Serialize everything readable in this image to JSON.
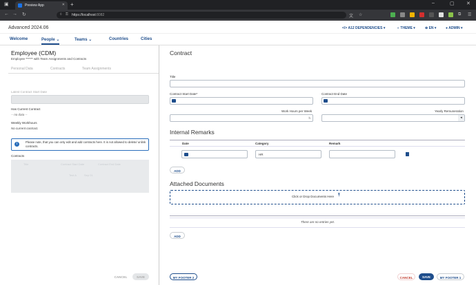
{
  "browser": {
    "tab_title": "Preview App",
    "url_host": "https://localhost",
    "url_port": ":8082"
  },
  "app": {
    "title": "Advanced 2024.06",
    "header": {
      "dependencies": "A12 DEPENDENCIES",
      "theme": "THEME",
      "language": "EN",
      "user": "ADMIN"
    },
    "nav": [
      "Welcome",
      "People",
      "Teams",
      "Countries",
      "Cities"
    ]
  },
  "left": {
    "title": "Employee (CDM)",
    "subtitle": "Employee ****** with Team Assignments and Contracts",
    "tabs": [
      "Personal Data",
      "Contracts",
      "Team Assignments"
    ],
    "latest_contract_label": "Latest Contract Start Date",
    "has_current_label": "Has Current Contract",
    "has_current_value": "-- no data --",
    "weekly_label": "Weekly Workhours",
    "weekly_value": "No current contract.",
    "info_text": "Please note, that you can only edit and add contracts here. It is not allowed to delete/ unlink contracts.",
    "contracts_label": "Contracts",
    "contracts_table": {
      "headers": [
        "Title",
        "Contract Start Date",
        "Contract End Date"
      ],
      "row": [
        "Test A",
        "Sep 01"
      ]
    },
    "cancel": "CANCEL",
    "save": "SAVE"
  },
  "right": {
    "title": "Contract",
    "title_label": "Title",
    "start_label": "Contract Start Date*",
    "end_label": "Contract End Date",
    "hours_label": "Work Hours per Week",
    "hours_unit": "h",
    "remun_label": "Yearly Remuneration",
    "remarks_title": "Internal Remarks",
    "remarks_headers": [
      "Date",
      "Category",
      "Remark"
    ],
    "remarks_category": "HR",
    "add": "ADD",
    "docs_title": "Attached Documents",
    "drop_text": "Click or Drop Documents Here",
    "no_entries": "There are no entries yet.",
    "add2": "ADD"
  },
  "footer": {
    "footer2": "MY FOOTER 2",
    "cancel": "CANCEL",
    "save": "SAVE",
    "footer1": "MY FOOTER 1"
  },
  "colors": {
    "primary": "#1f4e8c",
    "danger": "#c0392b",
    "info_border": "#2a6ebb"
  }
}
